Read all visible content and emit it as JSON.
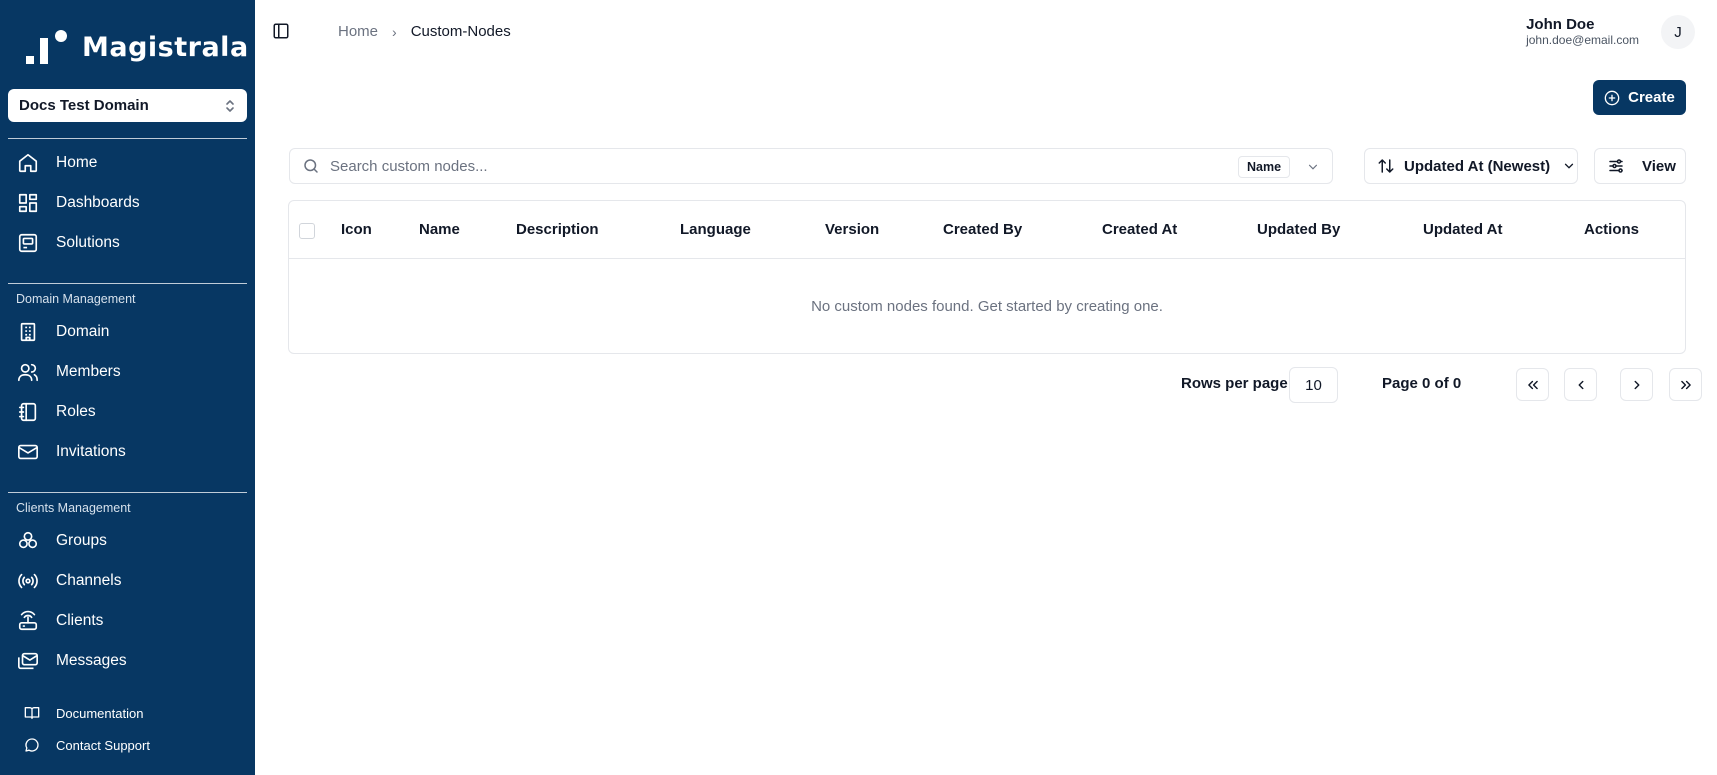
{
  "app": {
    "name": "Magistrala"
  },
  "sidebar": {
    "domain_selector": {
      "value": "Docs Test Domain"
    },
    "main_items": [
      {
        "label": "Home",
        "icon": "home-icon"
      },
      {
        "label": "Dashboards",
        "icon": "dashboard-icon"
      },
      {
        "label": "Solutions",
        "icon": "solutions-icon"
      }
    ],
    "domain_section": {
      "title": "Domain Management",
      "items": [
        {
          "label": "Domain",
          "icon": "building-icon"
        },
        {
          "label": "Members",
          "icon": "users-icon"
        },
        {
          "label": "Roles",
          "icon": "notebook-icon"
        },
        {
          "label": "Invitations",
          "icon": "mail-icon"
        }
      ]
    },
    "clients_section": {
      "title": "Clients Management",
      "items": [
        {
          "label": "Groups",
          "icon": "groups-icon"
        },
        {
          "label": "Channels",
          "icon": "radio-icon"
        },
        {
          "label": "Clients",
          "icon": "router-icon"
        },
        {
          "label": "Messages",
          "icon": "mails-icon"
        }
      ]
    },
    "footer_items": [
      {
        "label": "Documentation",
        "icon": "book-icon"
      },
      {
        "label": "Contact Support",
        "icon": "chat-icon"
      }
    ]
  },
  "header": {
    "breadcrumb": {
      "home": "Home",
      "separator": "›",
      "current": "Custom-Nodes"
    },
    "user": {
      "name": "John Doe",
      "email": "john.doe@email.com",
      "avatar_initial": "J"
    }
  },
  "toolbar": {
    "create_label": "Create",
    "search_placeholder": "Search custom nodes...",
    "search_field": "Name",
    "sort_label": "Updated At (Newest)",
    "view_label": "View"
  },
  "table": {
    "columns": [
      "Icon",
      "Name",
      "Description",
      "Language",
      "Version",
      "Created By",
      "Created At",
      "Updated By",
      "Updated At",
      "Actions"
    ],
    "empty_message": "No custom nodes found. Get started by creating one."
  },
  "pagination": {
    "rows_per_page_label": "Rows per page",
    "rows_per_page": "10",
    "page_info": "Page 0 of 0"
  },
  "colors": {
    "sidebar": "#073763",
    "accent": "#073763",
    "border": "#e5e7eb",
    "muted": "#6b7280"
  }
}
